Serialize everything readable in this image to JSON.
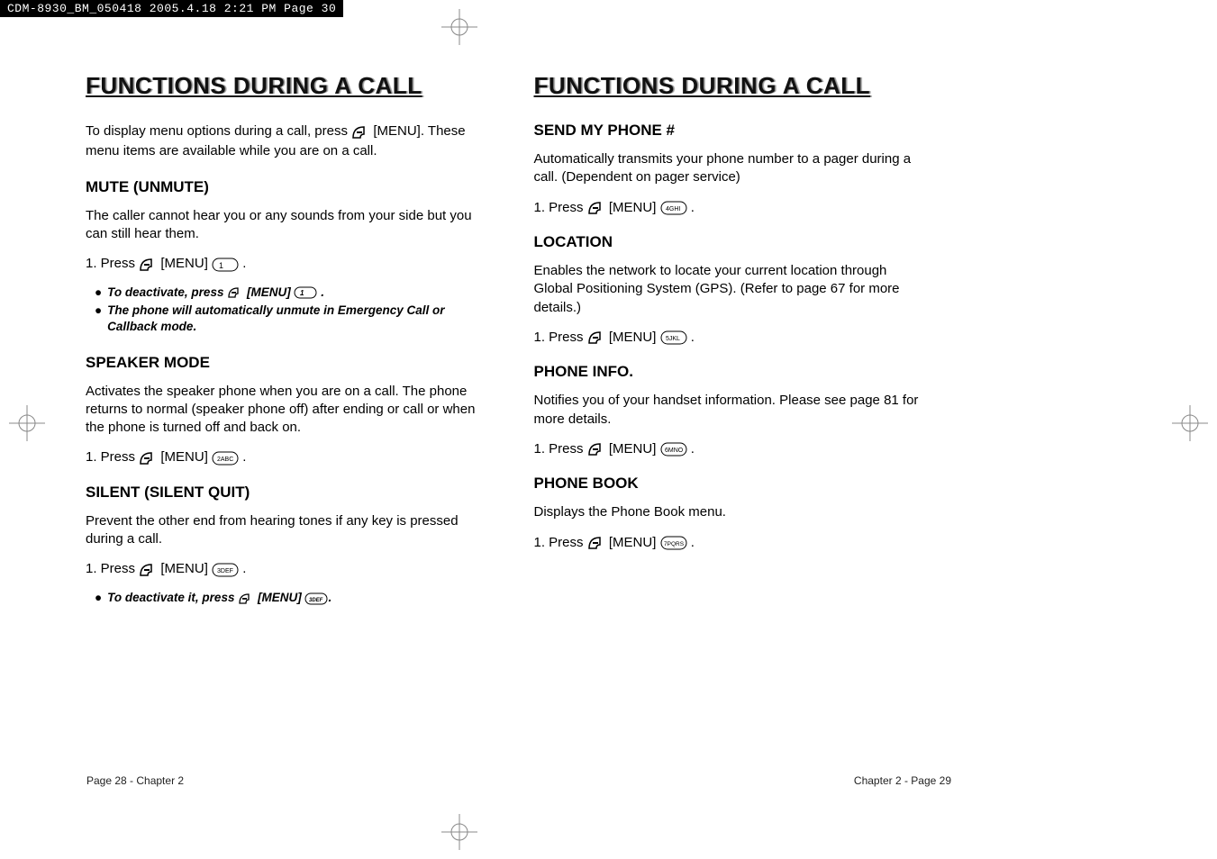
{
  "header": {
    "filestamp": "CDM-8930_BM_050418  2005.4.18  2:21 PM  Page 30"
  },
  "left": {
    "title": "FUNCTIONS DURING A CALL",
    "intro": "To display menu options during a call, press       [MENU]. These menu items are available while you are on a call.",
    "mute": {
      "heading": "MUTE (UNMUTE)",
      "body": "The caller cannot hear you or any sounds from your side but you can still hear them.",
      "step": "1. Press        [MENU]       .",
      "note1": "To deactivate, press       [MENU]       .",
      "note2": "The phone will automatically unmute in Emergency Call or Callback mode."
    },
    "speaker": {
      "heading": "SPEAKER MODE",
      "body": "Activates the speaker phone when you are on a call. The phone returns to normal (speaker phone off) after ending or call or when the phone is turned off and back on.",
      "step": "1. Press        [MENU]       ."
    },
    "silent": {
      "heading": "SILENT (SILENT QUIT)",
      "body": "Prevent the other end from hearing tones if any key is pressed during a call.",
      "step": "1. Press        [MENU]       .",
      "note1": "To deactivate it, press       [MENU]       ."
    },
    "footer": "Page 28 - Chapter 2"
  },
  "right": {
    "title": "FUNCTIONS DURING A CALL",
    "sendphone": {
      "heading": "SEND MY PHONE #",
      "body": "Automatically transmits your phone number to a pager during a call. (Dependent on pager service)",
      "step": "1. Press        [MENU]       ."
    },
    "location": {
      "heading": "LOCATION",
      "body": "Enables the network to locate your current location through Global Positioning System (GPS). (Refer to page 67 for more details.)",
      "step": "1. Press        [MENU]       ."
    },
    "phoneinfo": {
      "heading": "PHONE INFO.",
      "body": "Notifies you of your handset information. Please see page 81 for more details.",
      "step": "1. Press        [MENU]       ."
    },
    "phonebook": {
      "heading": "PHONE BOOK",
      "body": "Displays the Phone Book menu.",
      "step": "1. Press        [MENU]       ."
    },
    "footer": "Chapter 2 - Page 29"
  },
  "keys": {
    "softkey": "left-soft-key",
    "k1": "1",
    "k2": "2ABC",
    "k3": "3DEF",
    "k4": "4GHI",
    "k5": "5JKL",
    "k6": "6MNO",
    "k7": "7PQRS"
  }
}
